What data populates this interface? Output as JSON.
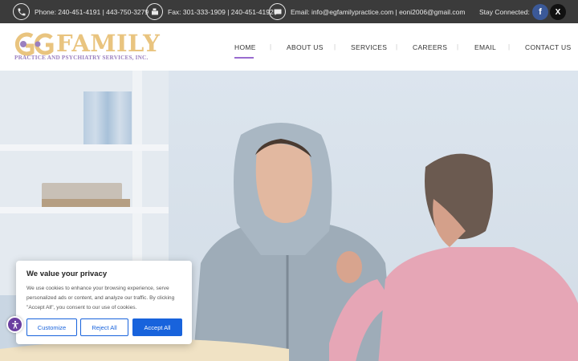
{
  "topbar": {
    "phone": "Phone: 240-451-4191 | 443-750-3279",
    "fax": "Fax: 301-333-1909 | 240-451-4192",
    "email": "Email: info@egfamilypractice.com | eoni2006@gmail.com",
    "stay_connected": "Stay Connected:",
    "social": [
      {
        "name": "facebook-icon",
        "glyph": "f",
        "color": "#3b5998"
      },
      {
        "name": "x-icon",
        "glyph": "X",
        "color": "#111111"
      }
    ]
  },
  "logo": {
    "word": "FAMILY",
    "tagline": "PRACTICE AND PSYCHIATRY SERVICES, INC."
  },
  "nav": {
    "items": [
      "HOME",
      "ABOUT US",
      "SERVICES",
      "CAREERS",
      "EMAIL",
      "CONTACT US"
    ],
    "active": "HOME",
    "accent": "#9a6ccf"
  },
  "cookie": {
    "title": "We value your privacy",
    "body": "We use cookies to enhance your browsing experience, serve personalized ads or content, and analyze our traffic. By clicking \"Accept All\", you consent to our use of cookies.",
    "customize": "Customize",
    "reject": "Reject All",
    "accept": "Accept All",
    "accent": "#1863dc"
  },
  "accessibility": {
    "icon": "accessibility-icon"
  }
}
